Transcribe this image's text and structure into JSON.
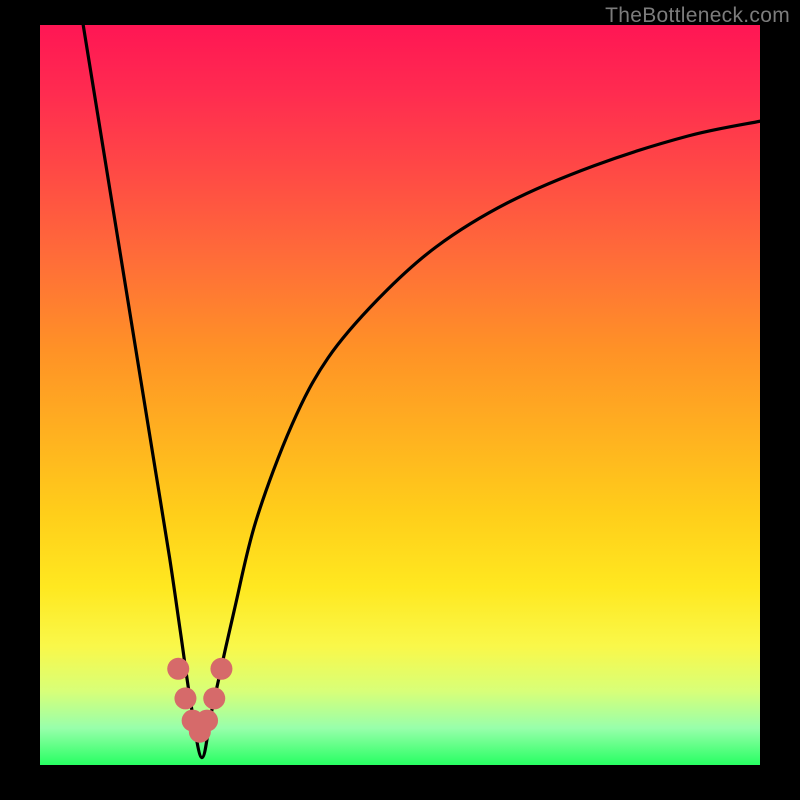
{
  "watermark": "TheBottleneck.com",
  "chart_data": {
    "type": "line",
    "title": "",
    "xlabel": "",
    "ylabel": "",
    "xlim": [
      0,
      100
    ],
    "ylim": [
      0,
      100
    ],
    "series": [
      {
        "name": "bottleneck-curve",
        "x": [
          6,
          8,
          10,
          12,
          14,
          16,
          18,
          19.5,
          21,
          22.5,
          24,
          27,
          30,
          35,
          40,
          47,
          55,
          65,
          77,
          90,
          100
        ],
        "y": [
          100,
          88,
          76,
          64,
          52,
          40,
          28,
          18,
          8,
          1,
          8,
          21,
          33,
          46,
          55,
          63,
          70,
          76,
          81,
          85,
          87
        ]
      }
    ],
    "markers": {
      "name": "bottleneck-dots",
      "color": "#d66a6a",
      "x": [
        19.2,
        20.2,
        21.2,
        22.2,
        23.2,
        24.2,
        25.2
      ],
      "y": [
        13,
        9,
        6,
        4.5,
        6,
        9,
        13
      ]
    },
    "gradient_stops": [
      {
        "pos": 0.0,
        "color": "#ff1654"
      },
      {
        "pos": 0.2,
        "color": "#ff4a45"
      },
      {
        "pos": 0.44,
        "color": "#ff9226"
      },
      {
        "pos": 0.66,
        "color": "#ffce1a"
      },
      {
        "pos": 0.84,
        "color": "#f9f84a"
      },
      {
        "pos": 0.95,
        "color": "#98ffab"
      },
      {
        "pos": 1.0,
        "color": "#27ff62"
      }
    ]
  }
}
